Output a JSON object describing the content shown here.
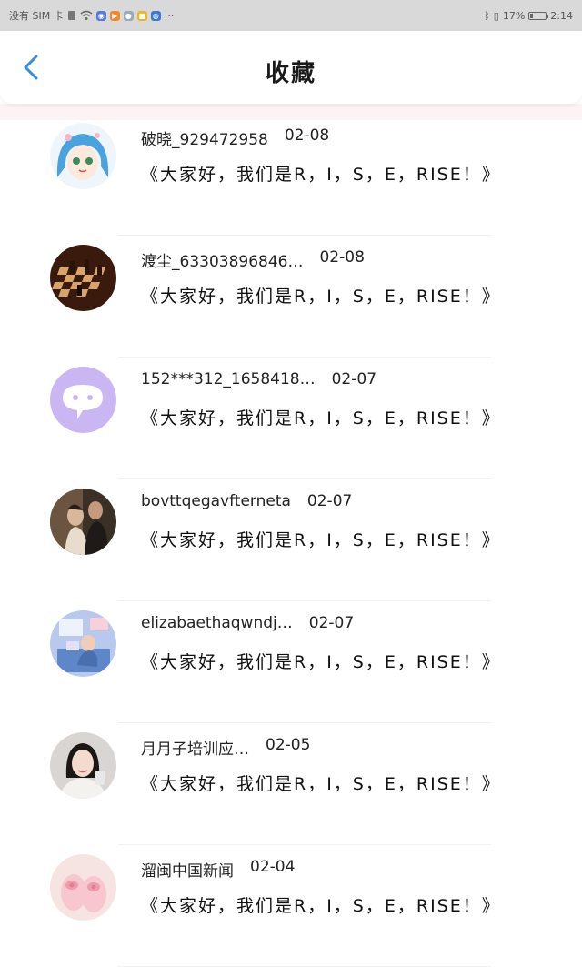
{
  "status_bar": {
    "carrier": "没有 SIM 卡",
    "battery_text": "17%",
    "time": "2:14",
    "battery_level": 0.17
  },
  "header": {
    "title": "收藏",
    "accent_color": "#2f8de4"
  },
  "favorites": [
    {
      "name": "破晓_929472958",
      "date": "02-08",
      "title": "《大家好，我们是R，I，S，E，RISE！》",
      "avatar": "anime-girl-avatar"
    },
    {
      "name": "渡尘_63303896846…",
      "date": "02-08",
      "title": "《大家好，我们是R，I，S，E，RISE！》",
      "avatar": "chessboard-avatar"
    },
    {
      "name": "152***312_1658418…",
      "date": "02-07",
      "title": "《大家好，我们是R，I，S，E，RISE！》",
      "avatar": "default-chat-avatar"
    },
    {
      "name": "bovttqegavfterneta",
      "date": "02-07",
      "title": "《大家好，我们是R，I，S，E，RISE！》",
      "avatar": "couple-photo-avatar"
    },
    {
      "name": "elizabaethaqwndj…",
      "date": "02-07",
      "title": "《大家好，我们是R，I，S，E，RISE！》",
      "avatar": "illustration-avatar"
    },
    {
      "name": "月月子培训应…",
      "date": "02-05",
      "title": "《大家好，我们是R，I，S，E，RISE！》",
      "avatar": "selfie-girl-avatar"
    },
    {
      "name": "溜闽中国新闻",
      "date": "02-04",
      "title": "《大家好，我们是R，I，S，E，RISE！》",
      "avatar": "pink-slippers-avatar"
    }
  ]
}
